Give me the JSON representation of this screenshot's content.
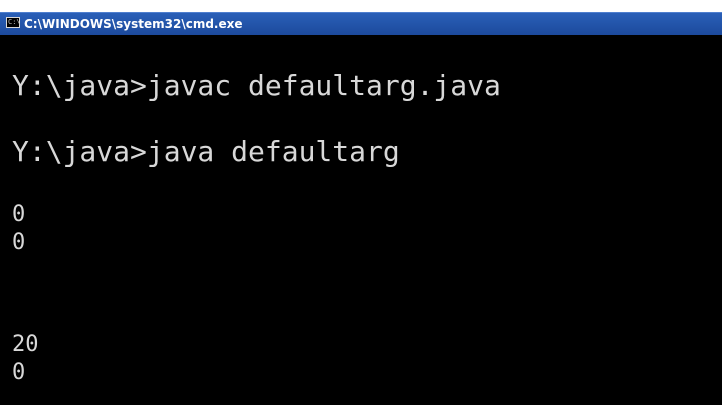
{
  "window": {
    "title": "C:\\WINDOWS\\system32\\cmd.exe",
    "icon": "cmd-icon"
  },
  "console": {
    "lines": [
      "Y:\\java>javac defaultarg.java",
      "Y:\\java>java defaultarg",
      "0",
      "0",
      "20",
      "0"
    ]
  },
  "colors": {
    "background": "#000000",
    "text": "#d8d8d8",
    "titlebar": "#2a60b8"
  }
}
